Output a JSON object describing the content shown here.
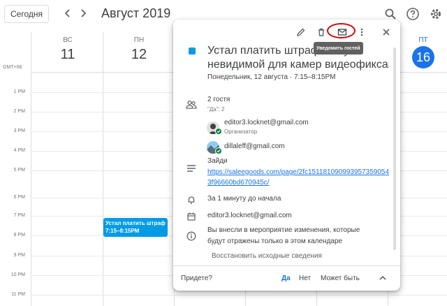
{
  "header": {
    "today_label": "Сегодня",
    "month_title": "Август 2019"
  },
  "calendar": {
    "days": [
      {
        "name": "ВС",
        "number": "11"
      },
      {
        "name": "ПН",
        "number": "12"
      },
      {
        "name": "ПТ",
        "number": "16"
      }
    ],
    "timezone": "GMT+06",
    "hours": [
      "1 PM",
      "2 PM",
      "3 PM",
      "4 PM",
      "5 PM",
      "6 PM",
      "7 PM",
      "8 PM",
      "9 PM",
      "10 PM",
      "11 PM"
    ],
    "event_chip": {
      "title": "Устал платить штраф",
      "time": "7:15–8:15PM",
      "color": "#039be5"
    }
  },
  "popup": {
    "tooltip": "Уведомить гостей",
    "title_line1": "Устал платить штрафы? Купи",
    "title_line2": "невидимой для камер видеофиксации",
    "when": "Понедельник, 12 августа  ·  7:15–8:15PM",
    "guests_count": "2 гостя",
    "guests_yes": "\"Да\": 2",
    "guests": [
      {
        "email": "editor3.locknet@gmail.com",
        "role": "Организатор"
      },
      {
        "email": "dillaleff@gmail.com",
        "role": ""
      }
    ],
    "description_label": "Зайди",
    "description_link": "https://saleegoods.com/page/2fc1511810909939573590543f96660bd670945c/",
    "reminder": "За 1 минуту до начала",
    "calendar_owner": "editor3.locknet@gmail.com",
    "notice": [
      "Вы внесли в мероприятие изменения, которые",
      "будут отражены только в этом календаре"
    ],
    "restore_label": "Восстановить исходные сведения",
    "footer": {
      "question": "Придете?",
      "yes": "Да",
      "no": "Нет",
      "maybe": "Может быть"
    },
    "icons": [
      "pencil-icon",
      "trash-icon",
      "mail-icon",
      "more-vert-icon",
      "close-icon"
    ]
  },
  "colors": {
    "accent": "#1a73e8",
    "event": "#039be5",
    "highlight_ring": "#d50000"
  }
}
